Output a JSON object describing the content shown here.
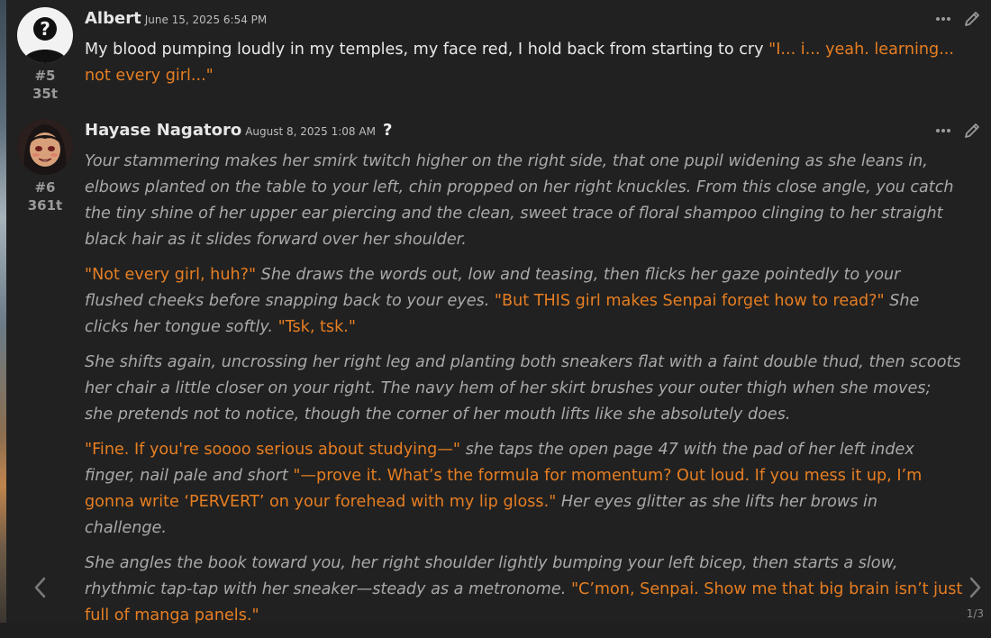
{
  "posts": [
    {
      "author": "Albert",
      "date": "June 15, 2025 6:54 PM",
      "number": "#5",
      "tokens": "35t",
      "body": {
        "p1": {
          "plain": "My blood pumping loudly in my temples, my face red, I hold back from starting to cry ",
          "say": "\"I... i... yeah. learning... not every girl...\""
        }
      }
    },
    {
      "author": "Hayase Nagatoro",
      "date": "August 8, 2025 1:08 AM",
      "badge": "?",
      "number": "#6",
      "tokens": "361t",
      "body": {
        "p1": "Your stammering makes her smirk twitch higher on the right side, that one pupil widening as she leans in, elbows planted on the table to your left, chin propped on her right knuckles. From this close angle, you catch the tiny shine of her upper ear piercing and the clean, sweet trace of floral shampoo clinging to her straight black hair as it slides forward over her shoulder.",
        "p2": {
          "s1": "\"Not every girl, huh?\"",
          "n1": " She draws the words out, low and teasing, then flicks her gaze pointedly to your flushed cheeks before snapping back to your eyes. ",
          "s2": "\"But THIS girl makes Senpai forget how to read?\"",
          "n2": " She clicks her tongue softly. ",
          "s3": "\"Tsk, tsk.\""
        },
        "p3": "She shifts again, uncrossing her right leg and planting both sneakers flat with a faint double thud, then scoots her chair a little closer on your right. The navy hem of her skirt brushes your outer thigh when she moves; she pretends not to notice, though the corner of her mouth lifts like she absolutely does.",
        "p4": {
          "s1": "\"Fine. If you're soooo serious about studying—\"",
          "n1": " she taps the open page 47 with the pad of her left index finger, nail pale and short ",
          "s2": "\"—prove it. What’s the formula for momentum? Out loud. If you mess it up, I’m gonna write ‘PERVERT’ on your forehead with my lip gloss.\"",
          "n2": " Her eyes glitter as she lifts her brows in challenge."
        },
        "p5": {
          "n1": "She angles the book toward you, her right shoulder lightly bumping your left bicep, then starts a slow, rhythmic tap-tap with her sneaker—steady as a metronome. ",
          "s1": "\"C’mon, Senpai. Show me that big brain isn’t just full of manga panels.\""
        }
      }
    }
  ],
  "pager": "1/3",
  "colors": {
    "dialogue": "#e67e22",
    "narration": "#a9a9a9",
    "background": "#212121"
  },
  "icons": [
    "more-options-icon",
    "edit-pencil-icon",
    "chevron-left-icon",
    "chevron-right-icon"
  ]
}
